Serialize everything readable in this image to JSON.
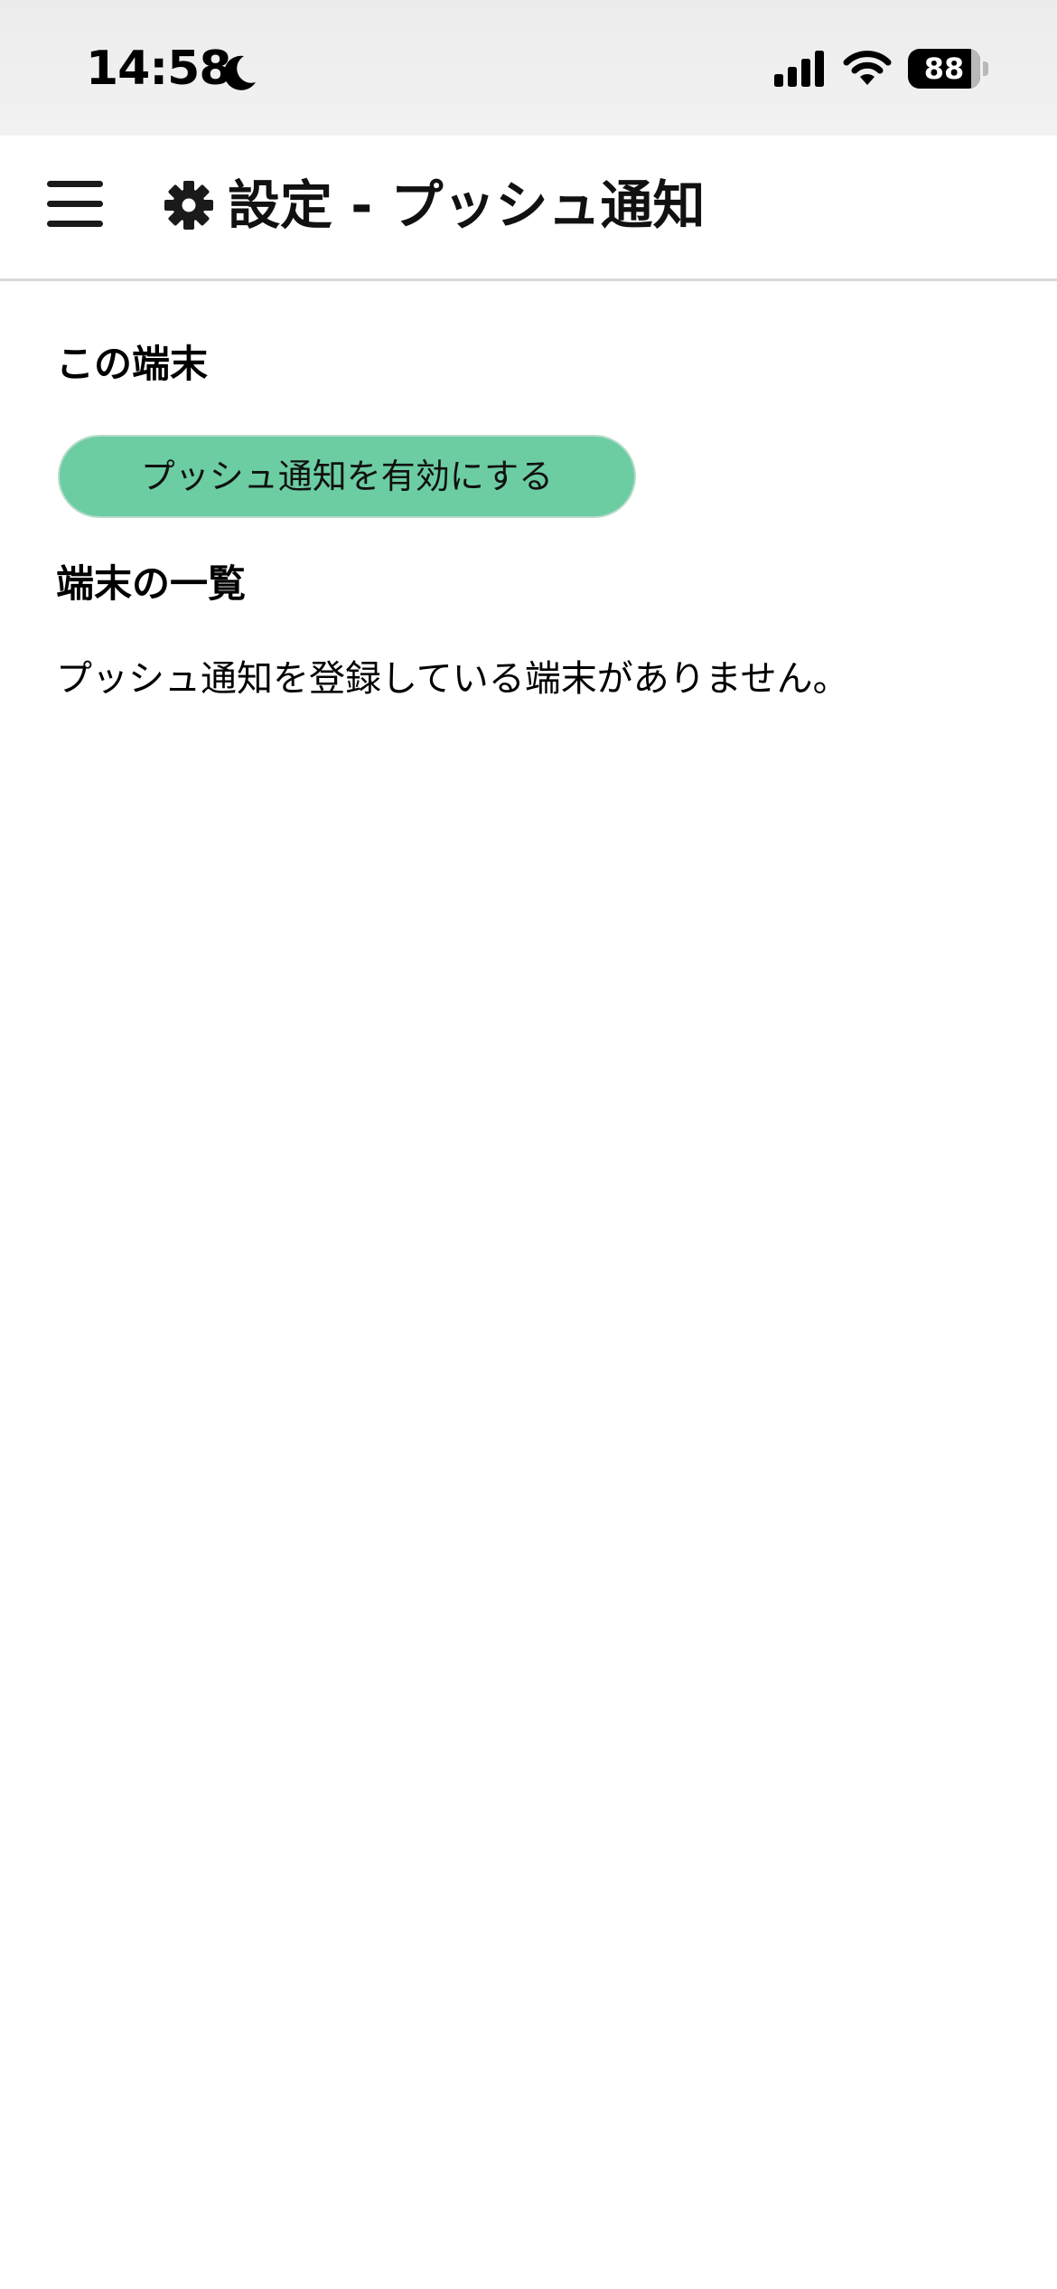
{
  "status_bar": {
    "time": "14:58",
    "battery_level": 88,
    "battery_label": "88"
  },
  "header": {
    "title": "設定 - プッシュ通知"
  },
  "this_device": {
    "heading": "この端末",
    "enable_button_label": "プッシュ通知を有効にする"
  },
  "device_list": {
    "heading": "端末の一覧",
    "empty_message": "プッシュ通知を登録している端末がありません。"
  },
  "colors": {
    "button_fill": "#6ccda3",
    "header_divider": "#d9d9d9"
  },
  "icons": {
    "status": [
      "moon-icon",
      "signal-icon",
      "wifi-icon",
      "battery-icon"
    ],
    "header": [
      "menu-icon",
      "gear-icon"
    ]
  }
}
